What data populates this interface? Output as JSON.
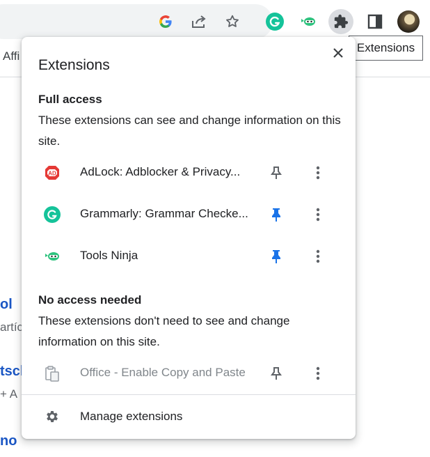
{
  "toolbar": {
    "icons": [
      "google-icon",
      "share-icon",
      "star-icon",
      "grammarly-icon",
      "tools-ninja-icon",
      "extensions-puzzle-icon",
      "side-panel-icon",
      "profile-avatar"
    ],
    "bookmark_text": "Affi"
  },
  "tooltip": {
    "text": "Extensions"
  },
  "background_page": {
    "fragments": [
      "ol",
      "artíc",
      "tscl",
      "+ A",
      "no"
    ]
  },
  "popup": {
    "title": "Extensions",
    "close_icon": "close-icon",
    "full_access": {
      "heading": "Full access",
      "description": "These extensions can see and change information on this site.",
      "extensions": [
        {
          "name": "AdLock: Adblocker & Privacy...",
          "icon": "adlock-icon",
          "pinned": false
        },
        {
          "name": "Grammarly: Grammar Checke...",
          "icon": "grammarly-icon",
          "pinned": true
        },
        {
          "name": "Tools Ninja",
          "icon": "tools-ninja-icon",
          "pinned": true
        }
      ]
    },
    "no_access": {
      "heading": "No access needed",
      "description": "These extensions don't need to see and change information on this site.",
      "extensions": [
        {
          "name": "Office - Enable Copy and Paste",
          "icon": "clipboard-icon",
          "pinned": false
        }
      ]
    },
    "manage": {
      "label": "Manage extensions",
      "icon": "gear-icon"
    }
  },
  "colors": {
    "pin_active": "#1a73e8",
    "pin_inactive": "#5f6368",
    "grammarly_green": "#15c39a",
    "adlock_red": "#e53935",
    "link_blue": "#1a56c4"
  }
}
